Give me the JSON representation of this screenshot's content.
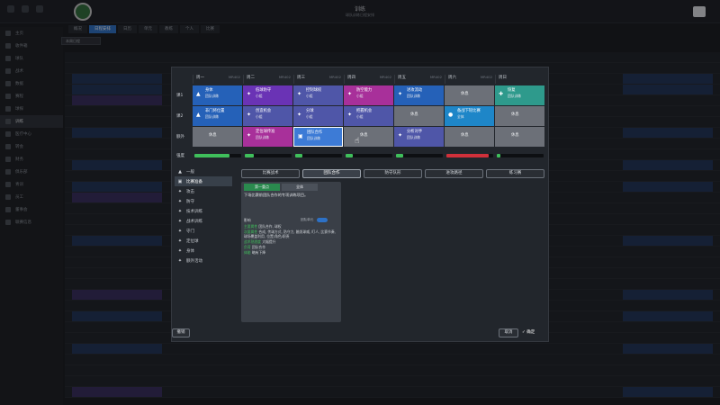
{
  "topbar": {
    "title": "训练",
    "subtitle": "球队训练日程安排",
    "date": "",
    "date_sub": ""
  },
  "sidebar": [
    {
      "label": "主页",
      "active": false
    },
    {
      "label": "收件箱",
      "active": false
    },
    {
      "label": "球队",
      "active": false
    },
    {
      "label": "战术",
      "active": false
    },
    {
      "label": "数据",
      "active": false
    },
    {
      "label": "赛程",
      "active": false
    },
    {
      "label": "球探",
      "active": false
    },
    {
      "label": "训练",
      "active": true
    },
    {
      "label": "医疗中心",
      "active": false
    },
    {
      "label": "转会",
      "active": false
    },
    {
      "label": "财务",
      "active": false
    },
    {
      "label": "俱乐部",
      "active": false
    },
    {
      "label": "青训",
      "active": false
    },
    {
      "label": "员工",
      "active": false
    },
    {
      "label": "董事会",
      "active": false
    },
    {
      "label": "联赛信息",
      "active": false
    }
  ],
  "tabs": [
    {
      "label": "概况",
      "active": false
    },
    {
      "label": "日程安排",
      "active": true
    },
    {
      "label": "日历",
      "active": false
    },
    {
      "label": "单元",
      "active": false
    },
    {
      "label": "教练",
      "active": false
    },
    {
      "label": "个人",
      "active": false
    },
    {
      "label": "比赛",
      "active": false
    }
  ],
  "filter": "本周日程",
  "modal": {
    "days": [
      {
        "label": "周一",
        "note": "MR402"
      },
      {
        "label": "周二",
        "note": "MR402"
      },
      {
        "label": "周三",
        "note": "MR402"
      },
      {
        "label": "周四",
        "note": "MR402"
      },
      {
        "label": "周五",
        "note": "MR402"
      },
      {
        "label": "周六",
        "note": "MR402"
      },
      {
        "label": "周日",
        "note": ""
      }
    ],
    "rows": [
      {
        "label": "课1",
        "cells": [
          {
            "title": "身体",
            "sub": "团队训练",
            "color": "#2561b8",
            "glyph": "▲"
          },
          {
            "title": "低球防守",
            "sub": "小组",
            "color": "#6a33b5",
            "glyph": "✦"
          },
          {
            "title": "控制球权",
            "sub": "小组",
            "color": "#4f56a8",
            "glyph": "✦"
          },
          {
            "title": "防空能力",
            "sub": "小组",
            "color": "#a8309a",
            "glyph": "✦"
          },
          {
            "title": "进攻流动",
            "sub": "团队训练",
            "color": "#2561b8",
            "glyph": "✦"
          },
          {
            "title": "休息",
            "sub": "",
            "color": "#6c7078",
            "glyph": ""
          },
          {
            "title": "恢复",
            "sub": "团队训练",
            "color": "#2e9a8c",
            "glyph": "✚"
          }
        ]
      },
      {
        "label": "课2",
        "cells": [
          {
            "title": "非门将位置",
            "sub": "团队训练",
            "color": "#2561b8",
            "glyph": "▲"
          },
          {
            "title": "创造机会",
            "sub": "小组",
            "color": "#4f56a8",
            "glyph": "✦"
          },
          {
            "title": "分球",
            "sub": "小组",
            "color": "#4f56a8",
            "glyph": "✦"
          },
          {
            "title": "把握机会",
            "sub": "小组",
            "color": "#4f56a8",
            "glyph": "✦"
          },
          {
            "title": "休息",
            "sub": "",
            "color": "#6c7078",
            "glyph": ""
          },
          {
            "title": "备战下轮比赛",
            "sub": "全体",
            "color": "#1e86c8",
            "glyph": "●"
          },
          {
            "title": "休息",
            "sub": "",
            "color": "#6c7078",
            "glyph": ""
          }
        ]
      },
      {
        "label": "额外",
        "cells": [
          {
            "title": "休息",
            "sub": "",
            "color": "#6c7078",
            "glyph": ""
          },
          {
            "title": "定位球传准",
            "sub": "团队训练",
            "color": "#a8309a",
            "glyph": "✦"
          },
          {
            "title": "团队合作",
            "sub": "团队训练",
            "color": "#3d7bd6",
            "glyph": "▣"
          },
          {
            "title": "休息",
            "sub": "",
            "color": "#6c7078",
            "glyph": ""
          },
          {
            "title": "分析对手",
            "sub": "团队训练",
            "color": "#4f56a8",
            "glyph": "✦"
          },
          {
            "title": "休息",
            "sub": "",
            "color": "#6c7078",
            "glyph": ""
          },
          {
            "title": "休息",
            "sub": "",
            "color": "#6c7078",
            "glyph": ""
          }
        ]
      }
    ],
    "intensity_label": "强度",
    "intensity": [
      {
        "level": 0.75,
        "color": "#3fbf5b"
      },
      {
        "level": 0.2,
        "color": "#3fbf5b"
      },
      {
        "level": 0.15,
        "color": "#3fbf5b"
      },
      {
        "level": 0.15,
        "color": "#3fbf5b"
      },
      {
        "level": 0.15,
        "color": "#3fbf5b"
      },
      {
        "level": 0.9,
        "color": "#d0303a"
      },
      {
        "level": 0.08,
        "color": "#3fbf5b"
      }
    ],
    "categories": [
      {
        "label": "一般",
        "glyph": "▲",
        "active": false
      },
      {
        "label": "比赛准备",
        "glyph": "▣",
        "active": true
      },
      {
        "label": "攻击",
        "glyph": "✦",
        "active": false
      },
      {
        "label": "防守",
        "glyph": "✦",
        "active": false
      },
      {
        "label": "技术训练",
        "glyph": "✦",
        "active": false
      },
      {
        "label": "战术训练",
        "glyph": "✦",
        "active": false
      },
      {
        "label": "守门",
        "glyph": "✦",
        "active": false
      },
      {
        "label": "定位球",
        "glyph": "✦",
        "active": false
      },
      {
        "label": "身体",
        "glyph": "✦",
        "active": false
      },
      {
        "label": "额外活动",
        "glyph": "✦",
        "active": false
      }
    ],
    "subtabs": [
      {
        "label": "比赛战术",
        "active": false
      },
      {
        "label": "团队合作",
        "active": true
      },
      {
        "label": "防守队形",
        "active": false
      },
      {
        "label": "进攻路径",
        "active": false
      },
      {
        "label": "练习赛",
        "active": false
      }
    ],
    "panel": {
      "tab_primary": "第一重点",
      "tab_secondary": "全体",
      "description": "下场比赛前团队合作的专项训练项目。",
      "info_label": "影响",
      "toggle_label": "团队单元",
      "lines": [
        {
          "key": "主要属性",
          "value": "团队合作, 球权"
        },
        {
          "key": "次要属性",
          "value": "合成, 传球方式, 防守力, 触发球威, 盯人, 比赛节奏, 球场覆盖利用, 位置/角色/职责"
        },
        {
          "key": "战术熟悉度",
          "value": "大幅提升"
        },
        {
          "key": "负荷",
          "value": "团队合作"
        },
        {
          "key": "体能",
          "value": "略有下降"
        }
      ]
    },
    "back_label": "撤销",
    "cancel_label": "取消",
    "ok_label": "✓ 确定"
  }
}
